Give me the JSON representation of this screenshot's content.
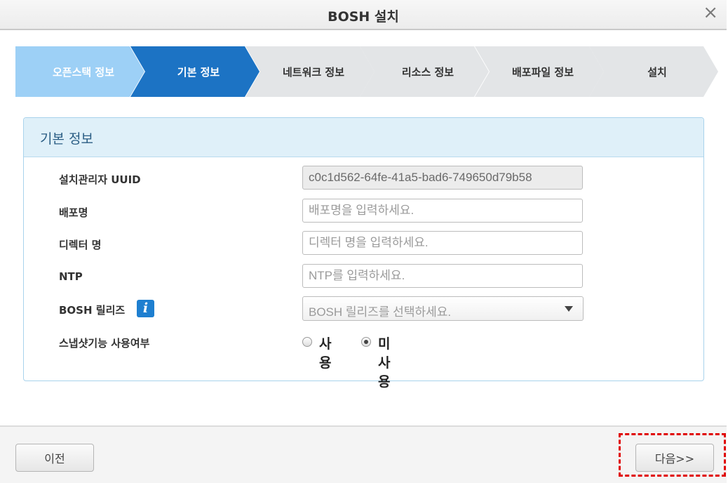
{
  "window": {
    "title": "BOSH 설치",
    "close_icon": "×"
  },
  "steps": [
    {
      "label": "오픈스택 정보",
      "state": "done"
    },
    {
      "label": "기본 정보",
      "state": "active"
    },
    {
      "label": "네트워크 정보",
      "state": "todo"
    },
    {
      "label": "리소스 정보",
      "state": "todo"
    },
    {
      "label": "배포파일 정보",
      "state": "todo"
    },
    {
      "label": "설치",
      "state": "todo"
    }
  ],
  "panel": {
    "title": "기본 정보",
    "fields": {
      "uuid": {
        "label": "설치관리자 UUID",
        "value": "c0c1d562-64fe-41a5-bad6-749650d79b58"
      },
      "deploy_name": {
        "label": "배포명",
        "placeholder": "배포명을 입력하세요."
      },
      "director_name": {
        "label": "디렉터 명",
        "placeholder": "디렉터 명을 입력하세요."
      },
      "ntp": {
        "label": "NTP",
        "placeholder": "NTP를 입력하세요."
      },
      "bosh_release": {
        "label": "BOSH 릴리즈",
        "info_icon": "i",
        "placeholder": "BOSH 릴리즈를 선택하세요."
      },
      "snapshot": {
        "label": "스냅샷기능 사용여부",
        "options": [
          "사용",
          "미사용"
        ],
        "selected": "미사용"
      }
    }
  },
  "footer": {
    "prev_label": "이전",
    "next_label": "다음>>"
  },
  "colors": {
    "step_done": "#9dd0f6",
    "step_active": "#1c73c4",
    "step_todo": "#e3e5e7",
    "highlight": "#e00000"
  }
}
